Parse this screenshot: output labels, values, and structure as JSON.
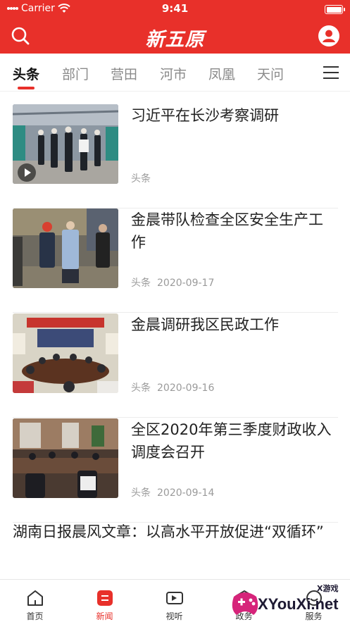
{
  "status_bar": {
    "carrier": "Carrier",
    "time": "9:41",
    "battery_level": 1.0
  },
  "header": {
    "logo": "新五原",
    "search_icon": "search-icon",
    "user_icon": "user-circle-icon",
    "accent_color": "#e8302a"
  },
  "tabs": [
    {
      "label": "头条",
      "active": true
    },
    {
      "label": "部门",
      "active": false
    },
    {
      "label": "营田",
      "active": false
    },
    {
      "label": "河市",
      "active": false
    },
    {
      "label": "凤凰",
      "active": false
    },
    {
      "label": "天问",
      "active": false
    }
  ],
  "tab_menu_icon": "menu-icon",
  "articles": [
    {
      "title": "习近平在长沙考察调研",
      "category": "头条",
      "date": "",
      "has_video": true,
      "thumb": "factory-visit-photo"
    },
    {
      "title": "金晨带队检查全区安全生产工作",
      "category": "头条",
      "date": "2020-09-17",
      "has_video": false,
      "thumb": "workshop-inspection-photo"
    },
    {
      "title": "金晨调研我区民政工作",
      "category": "头条",
      "date": "2020-09-16",
      "has_video": false,
      "thumb": "meeting-room-photo"
    },
    {
      "title": "全区2020年第三季度财政收入调度会召开",
      "category": "头条",
      "date": "2020-09-14",
      "has_video": false,
      "thumb": "conference-table-photo"
    }
  ],
  "text_article": {
    "title": "湖南日报晨风文章：以高水平开放促进“双循环”"
  },
  "bottom_nav": [
    {
      "label": "首页",
      "icon": "home-icon",
      "active": false
    },
    {
      "label": "新闻",
      "icon": "news-icon",
      "active": true
    },
    {
      "label": "视听",
      "icon": "video-camera-icon",
      "active": false
    },
    {
      "label": "政务",
      "icon": "government-icon",
      "active": false
    },
    {
      "label": "服务",
      "icon": "service-icon",
      "active": false
    }
  ],
  "watermark": {
    "text": "XYouXi.net",
    "small_text": "X游戏"
  }
}
